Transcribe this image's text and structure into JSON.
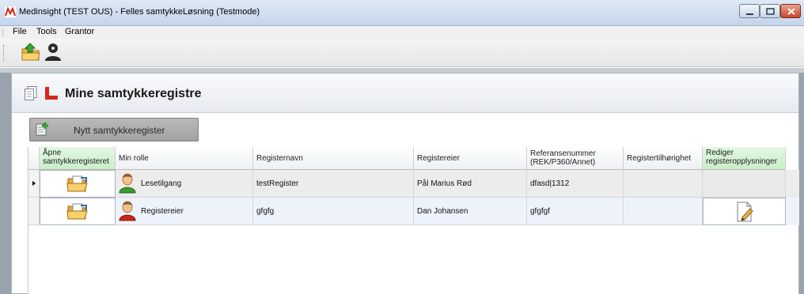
{
  "window": {
    "title": "Medinsight (TEST OUS) - Felles samtykkeLøsning (Testmode)",
    "icon": "medinsight-logo-icon"
  },
  "menu": {
    "items": [
      {
        "label": "File"
      },
      {
        "label": "Tools"
      },
      {
        "label": "Grantor"
      }
    ]
  },
  "toolbar": {
    "buttons": [
      {
        "icon": "open-folder-upload-icon"
      },
      {
        "icon": "user-key-icon"
      }
    ]
  },
  "page": {
    "title": "Mine samtykkeregistre",
    "new_button_label": "Nytt samtykkeregister"
  },
  "grid": {
    "columns": [
      "Åpne samtykkeregisteret",
      "Min rolle",
      "Registernavn",
      "Registereier",
      "Referansenummer (REK/P360/Annet)",
      "Registertilhørighet",
      "Rediger registeropplysninger"
    ],
    "rows": [
      {
        "role": "Lesetilgang",
        "register_name": "testRegister",
        "owner": "Pål Marius Rød",
        "reference": "dfasd|1312",
        "affiliation": "",
        "current": true
      },
      {
        "role": "Registereier",
        "register_name": "gfgfg",
        "owner": "Dan Johansen",
        "reference": "gfgfgf",
        "affiliation": "",
        "current": false
      }
    ]
  },
  "colors": {
    "accent_green_header": "#c9eec9",
    "logo_red": "#d9261c"
  }
}
